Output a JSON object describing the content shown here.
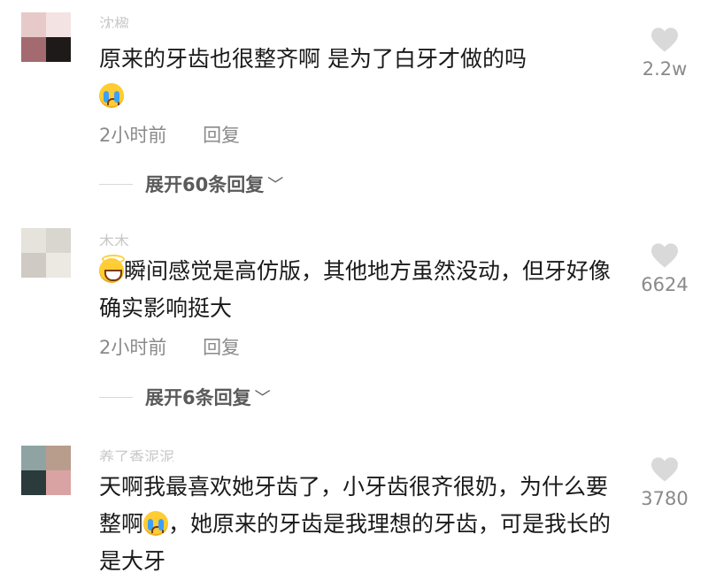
{
  "comments": [
    {
      "username": "沈楹",
      "text_before": "原来的牙齿也很整齐啊  是为了白牙才做的吗",
      "emoji": "crying-face",
      "text_after": "",
      "time": "2小时前",
      "reply": "回复",
      "expand": "展开60条回复",
      "likes": "2.2w",
      "avatar_colors": [
        "#e8c9c9",
        "#f4e3e3",
        "#a36a6f",
        "#1f1a1a"
      ]
    },
    {
      "username": "木木",
      "emoji": "grinning-sweat-face",
      "text_before": "",
      "text_after": "瞬间感觉是高仿版，其他地方虽然没动，但牙好像确实影响挺大",
      "time": "2小时前",
      "reply": "回复",
      "expand": "展开6条回复",
      "likes": "6624",
      "avatar_colors": [
        "#e6e2dc",
        "#d9d5cf",
        "#cfcac3",
        "#ece8e2"
      ]
    },
    {
      "username": "养了香泥泥",
      "text_before": "天啊我最喜欢她牙齿了，小牙齿很齐很奶，为什么要整啊",
      "emoji": "crying-face",
      "text_after": "，她原来的牙齿是我理想的牙齿，可是我长的是大牙",
      "time": "",
      "reply": "",
      "expand": "",
      "likes": "3780",
      "avatar_colors": [
        "#8fa3a3",
        "#b89c8c",
        "#2b3a3a",
        "#d9a3a3"
      ]
    }
  ],
  "colors": {
    "text": "#1a1a1a",
    "meta": "#8a8a8a",
    "heart": "#d9d9d9"
  }
}
